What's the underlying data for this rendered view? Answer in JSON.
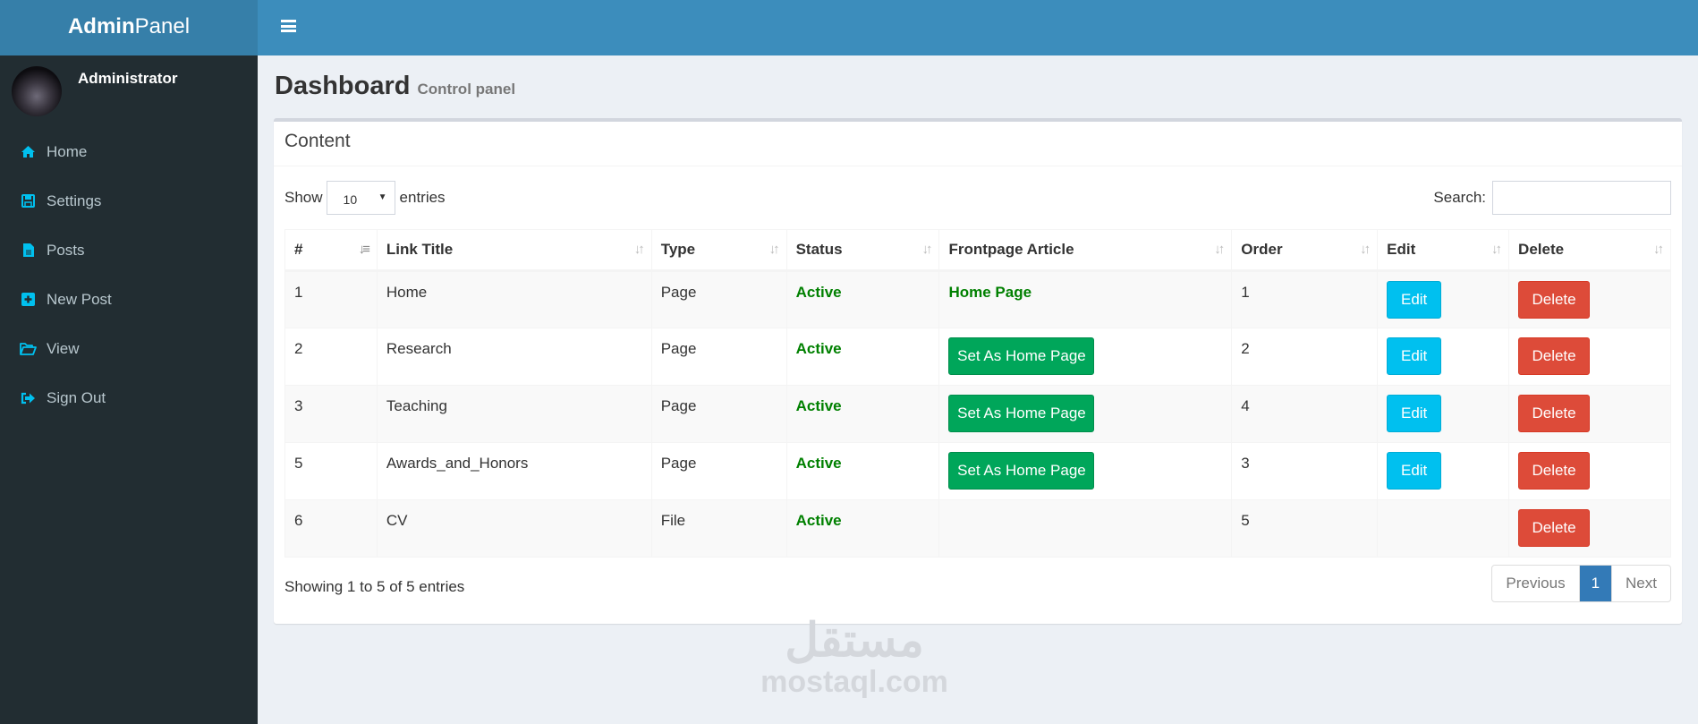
{
  "app": {
    "logo_bold": "Admin",
    "logo_light": "Panel"
  },
  "user": {
    "name": "Administrator"
  },
  "sidebar": {
    "items": [
      {
        "label": "Home",
        "icon": "home-icon"
      },
      {
        "label": "Settings",
        "icon": "floppy-disk-icon"
      },
      {
        "label": "Posts",
        "icon": "file-icon"
      },
      {
        "label": "New Post",
        "icon": "plus-square-icon"
      },
      {
        "label": "View",
        "icon": "folder-open-icon"
      },
      {
        "label": "Sign Out",
        "icon": "sign-out-icon"
      }
    ]
  },
  "page": {
    "title": "Dashboard",
    "subtitle": "Control panel"
  },
  "box": {
    "title": "Content",
    "show_label": "Show",
    "entries_label": "entries",
    "page_length": "10",
    "search_label": "Search:",
    "search_value": "",
    "info": "Showing 1 to 5 of 5 entries",
    "pagination": {
      "previous": "Previous",
      "current": "1",
      "next": "Next"
    }
  },
  "table": {
    "columns": [
      "#",
      "Link Title",
      "Type",
      "Status",
      "Frontpage Article",
      "Order",
      "Edit",
      "Delete"
    ],
    "rows": [
      {
        "id": "1",
        "title": "Home",
        "type": "Page",
        "status": "Active",
        "frontpage": "Home Page",
        "frontpage_is_home": true,
        "order": "1",
        "edit": "Edit",
        "delete": "Delete"
      },
      {
        "id": "2",
        "title": "Research",
        "type": "Page",
        "status": "Active",
        "frontpage": "Set As Home Page",
        "frontpage_is_home": false,
        "order": "2",
        "edit": "Edit",
        "delete": "Delete"
      },
      {
        "id": "3",
        "title": "Teaching",
        "type": "Page",
        "status": "Active",
        "frontpage": "Set As Home Page",
        "frontpage_is_home": false,
        "order": "4",
        "edit": "Edit",
        "delete": "Delete"
      },
      {
        "id": "5",
        "title": "Awards_and_Honors",
        "type": "Page",
        "status": "Active",
        "frontpage": "Set As Home Page",
        "frontpage_is_home": false,
        "order": "3",
        "edit": "Edit",
        "delete": "Delete"
      },
      {
        "id": "6",
        "title": "CV",
        "type": "File",
        "status": "Active",
        "frontpage": "",
        "frontpage_is_home": false,
        "order": "5",
        "edit": "",
        "delete": "Delete"
      }
    ]
  },
  "watermark": {
    "arabic": "مستقل",
    "latin": "mostaql.com"
  },
  "colors": {
    "header": "#3c8dbc",
    "logo_bg": "#367fa9",
    "sidebar": "#222d32",
    "edit": "#00c0ef",
    "delete": "#dd4b39",
    "set_home": "#00a65a",
    "status_active": "#008000"
  }
}
